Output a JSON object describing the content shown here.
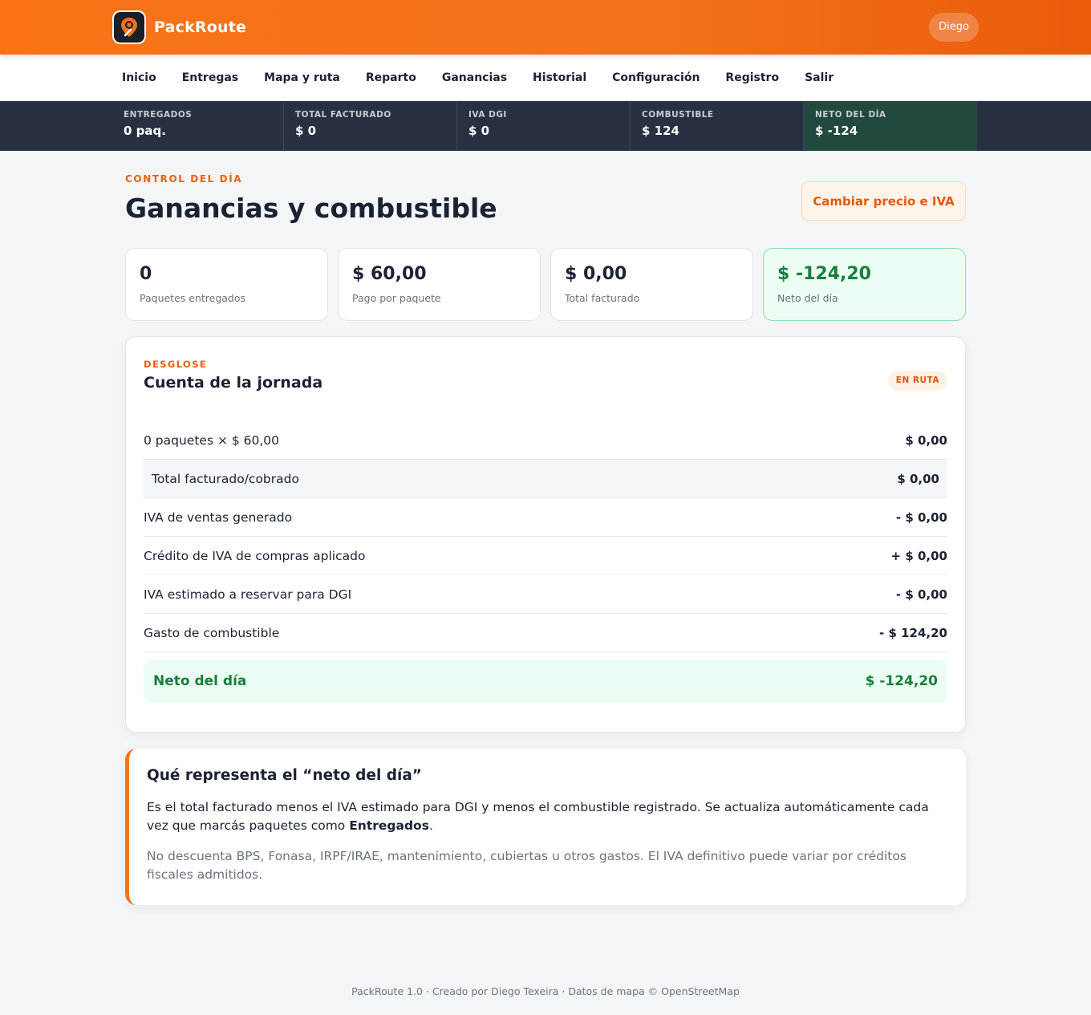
{
  "app": {
    "name": "PackRoute",
    "user": "Diego"
  },
  "nav": [
    "Inicio",
    "Entregas",
    "Mapa y ruta",
    "Reparto",
    "Ganancias",
    "Historial",
    "Configuración",
    "Registro",
    "Salir"
  ],
  "stats": [
    {
      "label": "ENTREGADOS",
      "value": "0 paq."
    },
    {
      "label": "TOTAL FACTURADO",
      "value": "$ 0"
    },
    {
      "label": "IVA DGI",
      "value": "$ 0"
    },
    {
      "label": "COMBUSTIBLE",
      "value": "$ 124"
    },
    {
      "label": "NETO DEL DÍA",
      "value": "$ -124"
    }
  ],
  "page": {
    "eyebrow": "CONTROL DEL DÍA",
    "title": "Ganancias y combustible",
    "change_button": "Cambiar precio e IVA"
  },
  "cards": [
    {
      "value": "0",
      "label": "Paquetes entregados"
    },
    {
      "value": "$ 60,00",
      "label": "Pago por paquete"
    },
    {
      "value": "$ 0,00",
      "label": "Total facturado"
    },
    {
      "value": "$ -124,20",
      "label": "Neto del día"
    }
  ],
  "breakdown": {
    "eyebrow": "DESGLOSE",
    "title": "Cuenta de la jornada",
    "badge": "EN RUTA",
    "rows": [
      {
        "label": "0 paquetes × $ 60,00",
        "value": "$ 0,00"
      },
      {
        "label": "Total facturado/cobrado",
        "value": "$ 0,00"
      },
      {
        "label": "IVA de ventas generado",
        "value": "- $ 0,00"
      },
      {
        "label": "Crédito de IVA de compras aplicado",
        "value": "+ $ 0,00"
      },
      {
        "label": "IVA estimado a reservar para DGI",
        "value": "- $ 0,00"
      },
      {
        "label": "Gasto de combustible",
        "value": "- $ 124,20"
      }
    ],
    "net_label": "Neto del día",
    "net_value": "$ -124,20"
  },
  "info": {
    "title": "Qué representa el “neto del día”",
    "p1_before": "Es el total facturado menos el IVA estimado para DGI y menos el combustible registrado. Se actualiza automáticamente cada vez que marcás paquetes como ",
    "p1_bold": "Entregados",
    "p1_after": ".",
    "p2": "No descuenta BPS, Fonasa, IRPF/IRAE, mantenimiento, cubiertas u otros gastos. El IVA definitivo puede variar por créditos fiscales admitidos."
  },
  "footer": "PackRoute 1.0 · Creado por Diego Texeira · Datos de mapa © OpenStreetMap"
}
